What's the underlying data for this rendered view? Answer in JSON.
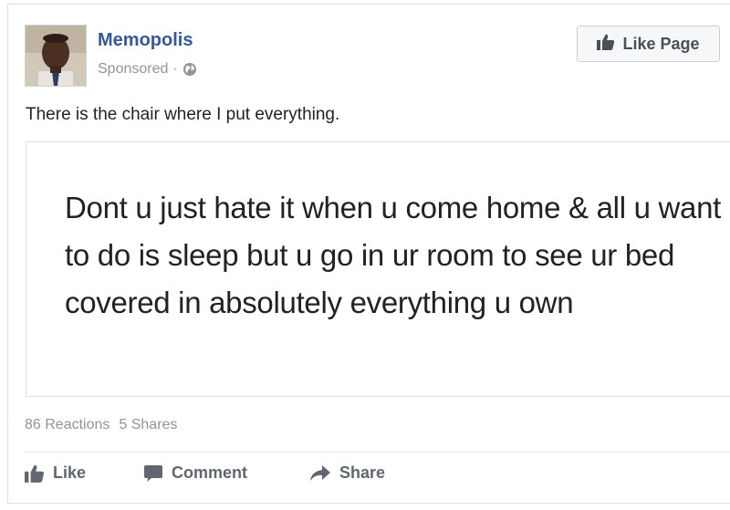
{
  "post": {
    "page_name": "Memopolis",
    "sponsored_label": "Sponsored",
    "separator": "·",
    "privacy_icon": "globe-icon",
    "like_page_label": "Like Page",
    "text": "There is the chair where I put everything.",
    "media_text": "Dont u just hate it when u come home & all u want to do is sleep but u go in ur room to see ur bed covered in absolutely everything u own"
  },
  "stats": {
    "reactions": "86 Reactions",
    "shares": "5 Shares"
  },
  "actions": {
    "like_label": "Like",
    "comment_label": "Comment",
    "share_label": "Share"
  },
  "colors": {
    "link_blue": "#365899",
    "meta_grey": "#90949c",
    "action_grey": "#606770",
    "border": "#dddfe2"
  }
}
